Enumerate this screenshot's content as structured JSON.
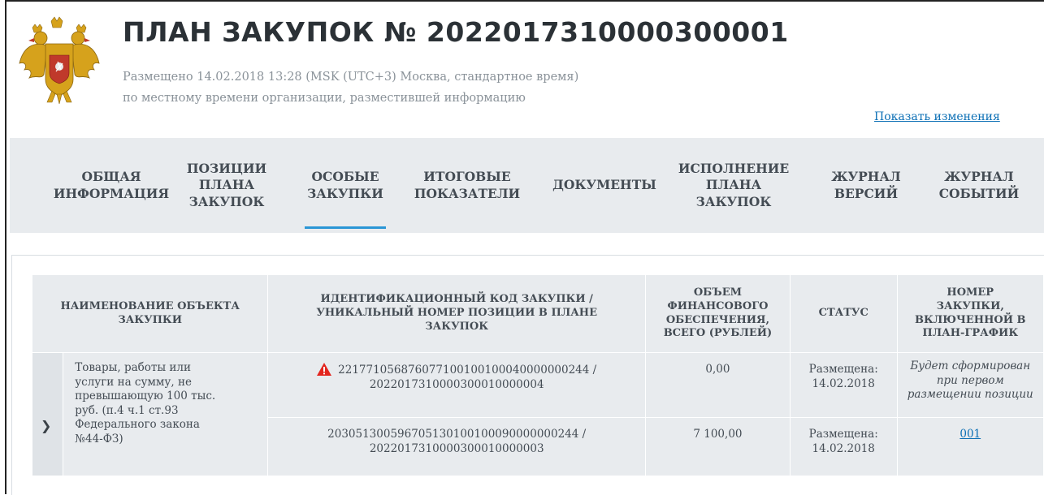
{
  "header": {
    "title": "ПЛАН ЗАКУПОК № 2022017310000300001",
    "published": "Размещено 14.02.2018 13:28 (MSK (UTC+3) Москва, стандартное время)",
    "published_note": "по местному времени организации, разместившей информацию",
    "show_changes": "Показать изменения",
    "emblem": "russian-coat-of-arms-icon"
  },
  "tabs": [
    {
      "l1": "ОБЩАЯ",
      "l2": "ИНФОРМАЦИЯ",
      "l3": ""
    },
    {
      "l1": "ПОЗИЦИИ",
      "l2": "ПЛАНА",
      "l3": "ЗАКУПОК"
    },
    {
      "l1": "ОСОБЫЕ",
      "l2": "ЗАКУПКИ",
      "l3": "",
      "active": true
    },
    {
      "l1": "ИТОГОВЫЕ",
      "l2": "ПОКАЗАТЕЛИ",
      "l3": ""
    },
    {
      "l1": "ДОКУМЕНТЫ",
      "l2": "",
      "l3": ""
    },
    {
      "l1": "ИСПОЛНЕНИЕ",
      "l2": "ПЛАНА",
      "l3": "ЗАКУПОК"
    },
    {
      "l1": "ЖУРНАЛ",
      "l2": "ВЕРСИЙ",
      "l3": ""
    },
    {
      "l1": "ЖУРНАЛ",
      "l2": "СОБЫТИЙ",
      "l3": ""
    }
  ],
  "table": {
    "headers": {
      "name": [
        "НАИМЕНОВАНИЕ ОБЪЕКТА",
        "ЗАКУПКИ"
      ],
      "code": [
        "ИДЕНТИФИКАЦИОННЫЙ КОД ЗАКУПКИ /",
        "УНИКАЛЬНЫЙ НОМЕР ПОЗИЦИИ В ПЛАНЕ",
        "ЗАКУПОК"
      ],
      "volume": [
        "ОБЪЕМ",
        "ФИНАНСОВОГО",
        "ОБЕСПЕЧЕНИЯ,",
        "ВСЕГО (РУБЛЕЙ)"
      ],
      "status": [
        "СТАТУС"
      ],
      "number": [
        "НОМЕР",
        "ЗАКУПКИ,",
        "ВКЛЮЧЕННОЙ В",
        "ПЛАН-ГРАФИК"
      ]
    },
    "group": {
      "name_lines": [
        "Товары, работы или",
        "услуги на сумму, не",
        "превышающую 100 тыс.",
        "руб. (п.4 ч.1 ст.93",
        "Федерального закона",
        "№44-ФЗ)"
      ],
      "expander_icon": "chevron-down-icon"
    },
    "rows": [
      {
        "warning_icon": "warning-triangle-icon",
        "code_line1": "221771056876077100100100040000000244 /",
        "code_line2": "2022017310000300010000004",
        "code_color": "#e3261f",
        "volume": "0,00",
        "status_line1": "Размещена:",
        "status_line2": "14.02.2018",
        "number_lines": [
          "Будет сформирован",
          "при первом",
          "размещении позиции"
        ]
      },
      {
        "code_line1": "203051300596705130100100090000000244 /",
        "code_line2": "2022017310000300010000003",
        "volume": "7 100,00",
        "status_line1": "Размещена:",
        "status_line2": "14.02.2018",
        "number_link": "001"
      }
    ]
  }
}
